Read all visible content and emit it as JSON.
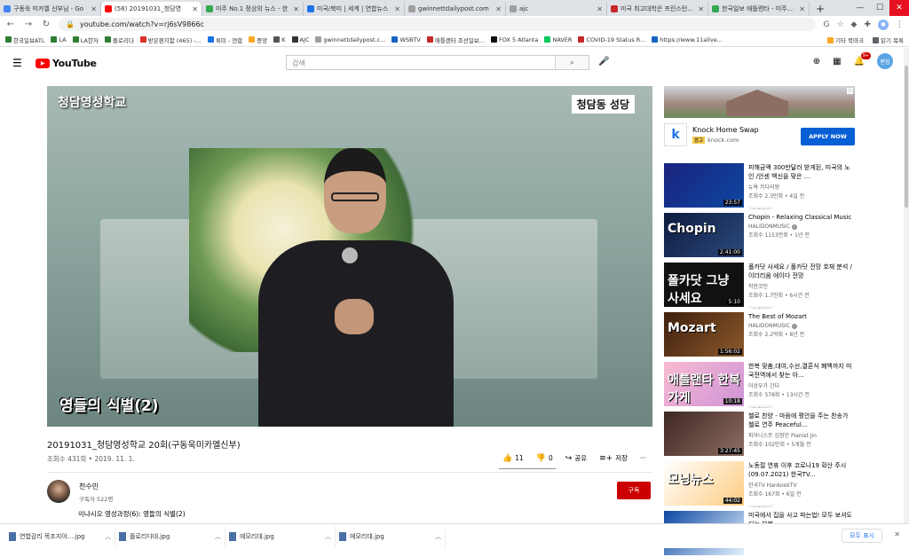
{
  "tabs": [
    {
      "label": "구동욱 미카엘 신부님 - Go",
      "fav": "#4285f4"
    },
    {
      "label": "(58) 20191031_청담영",
      "fav": "#ff0000",
      "active": true
    },
    {
      "label": "미주 No.1 정상의 뉴스 - 한",
      "fav": "#34a853"
    },
    {
      "label": "미국/북미 | 세계 | 연합뉴스",
      "fav": "#1a73e8"
    },
    {
      "label": "gwinnettdailypost.com",
      "fav": "#9e9e9e"
    },
    {
      "label": "ajc",
      "fav": "#9e9e9e"
    },
    {
      "label": "미국 최고대학은 프린스턴...",
      "fav": "#c62828"
    },
    {
      "label": "한국일보 애틀랜타 - 미주...",
      "fav": "#34a853"
    }
  ],
  "newtab": "+",
  "url": "youtube.com/watch?v=rj6sV9866c",
  "bookmarks": [
    {
      "label": "한국일보ATL",
      "c": "#2e7d32"
    },
    {
      "label": "LA",
      "c": "#2e7d32"
    },
    {
      "label": "LA한자",
      "c": "#2e7d32"
    },
    {
      "label": "플로리다",
      "c": "#2e7d32"
    },
    {
      "label": "받은편지함 (465) -...",
      "c": "#d93025"
    },
    {
      "label": "록미 - 연합",
      "c": "#1a73e8"
    },
    {
      "label": "중앙",
      "c": "#f9a825"
    },
    {
      "label": "K",
      "c": "#555"
    },
    {
      "label": "AJC",
      "c": "#333"
    },
    {
      "label": "gwinnettdailypost.c...",
      "c": "#9e9e9e"
    },
    {
      "label": "WSBTV",
      "c": "#1565c0"
    },
    {
      "label": "애틀랜타 조선일보...",
      "c": "#c62828"
    },
    {
      "label": "FOX 5 Atlanta",
      "c": "#111"
    },
    {
      "label": "NAVER",
      "c": "#03c75a"
    },
    {
      "label": "COVID-19 Status R...",
      "c": "#c62828"
    },
    {
      "label": "https://www.11alive...",
      "c": "#1565c0"
    }
  ],
  "bookmarks_right": {
    "other": "기타 북마크",
    "reading": "읽기 목록"
  },
  "yt": {
    "logo": "YouTube",
    "search_placeholder": "검색",
    "avatar": "편집",
    "notif": "9+"
  },
  "video": {
    "overlay_tl": "청담영성학교",
    "overlay_tr": "청담동 성당",
    "overlay_bl": "영들의 식별(2)",
    "title": "20191031_청담영성학교 20회(구동욱미카엘신부)",
    "stats": "조회수 431회 • 2019. 11. 1.",
    "likes": "11",
    "dislikes": "0",
    "share": "공유",
    "save": "저장",
    "more": "···"
  },
  "channel": {
    "name": "천수민",
    "subs": "구독자 522명",
    "subscribe": "구독"
  },
  "description": "이냐시오 영성과정(6): 영들의 식별(2)",
  "ad": {
    "title": "Knock Home Swap",
    "tag": "광고",
    "domain": "knock.com",
    "cta": "APPLY NOW"
  },
  "recs": [
    {
      "title": "피해금액 300만달러 받게된, 미국의 노인 /안센 백신을 맞은 ...",
      "channel": "뉴욕 키다리형",
      "meta": "조회수 2.3만회 • 4일 전",
      "dur": "23:57",
      "new": "새 동영상",
      "bg": "linear-gradient(135deg,#1a237e,#0d47a1)",
      "tt": ""
    },
    {
      "title": "Chopin - Relaxing Classical Music",
      "channel": "HALIDONMUSIC",
      "meta": "조회수 1153만회 • 1년 전",
      "dur": "2:41:00",
      "bg": "linear-gradient(135deg,#0d1b3e,#2b4a7e)",
      "tt": "Chopin",
      "verified": true
    },
    {
      "title": "폴카닷 사세요 / 폴카닷 전망 호재 분석 / 이더리움 에이다 전망",
      "channel": "착한코인",
      "meta": "조회수 1.7만회 • 6시간 전",
      "dur": "5:10",
      "new": "새 동영상",
      "bg": "#111",
      "tt": "폴카닷 그냥 사세요"
    },
    {
      "title": "The Best of Mozart",
      "channel": "HALIDONMUSIC",
      "meta": "조회수 2.2억회 • 8년 전",
      "dur": "1:56:02",
      "bg": "linear-gradient(135deg,#3e1f0d,#8d5a2b)",
      "tt": "Mozart",
      "verified": true
    },
    {
      "title": "한복 맞춤,대여,수선,결혼식 폐백까지 미국전역에서 찾는 아...",
      "channel": "이상우가 간다",
      "meta": "조회수 578회 • 13시간 전",
      "dur": "10:18",
      "new": "새 동영상",
      "bg": "linear-gradient(135deg,#f8bbd0,#ce93d8)",
      "tt": "애틀랜타 한복가게"
    },
    {
      "title": "첼로 찬양 - 마음에 평안을 주는 찬송가 첼로 연주 Peaceful...",
      "channel": "피아니스트 김정민 Pianist Jin",
      "meta": "조회수 102만회 • 5개월 전",
      "dur": "3:27:45",
      "bg": "linear-gradient(135deg,#3e2723,#8d6e63)",
      "tt": ""
    },
    {
      "title": "노동절 연휴 이후 코로나19 확산 주시 (09.07.2021) 한국TV...",
      "channel": "한국TV HankookTV",
      "meta": "조회수 167회 • 6일 전",
      "dur": "44:02",
      "new": "새 동영상",
      "bg": "linear-gradient(135deg,#fff,#ffcc80)",
      "tt": "모닝뉴스"
    },
    {
      "title": "미국에서 집을 사고 파는법! 모두 보셔도 되는 부분",
      "channel": "",
      "meta": "",
      "dur": "",
      "bg": "linear-gradient(135deg,#0d47a1,#e3f2fd)",
      "tt": ""
    }
  ],
  "downloads": [
    {
      "name": "연합감리 목조지야....jpg"
    },
    {
      "name": "플로리다대.jpg"
    },
    {
      "name": "에모리대.jpg"
    },
    {
      "name": "에모리대.jpg"
    }
  ],
  "show_all": "모두 표시"
}
